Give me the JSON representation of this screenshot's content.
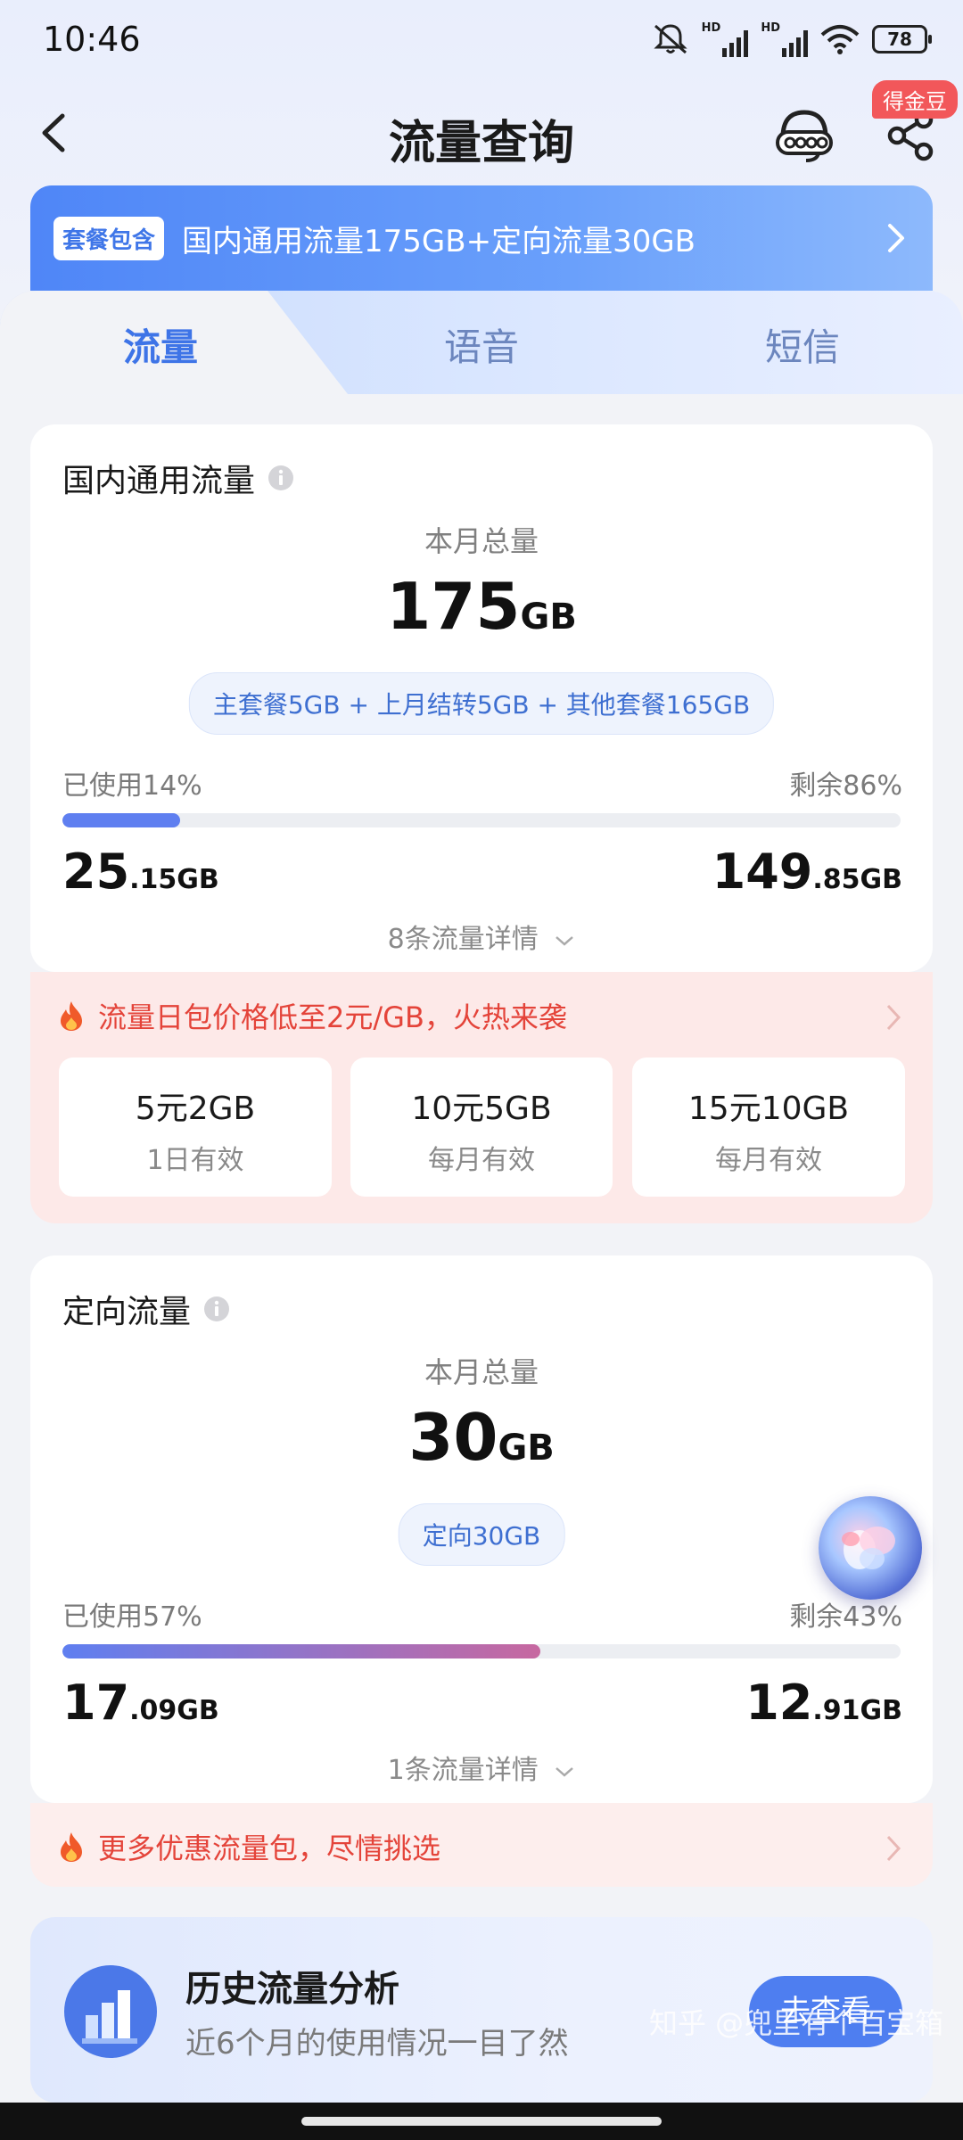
{
  "status_bar": {
    "time": "10:46",
    "battery": "78",
    "hd1": "HD",
    "hd2": "HD"
  },
  "nav": {
    "title": "流量查询",
    "badge": "得金豆"
  },
  "banner": {
    "tag": "套餐包含",
    "text": "国内通用流量175GB+定向流量30GB"
  },
  "tabs": [
    {
      "label": "流量"
    },
    {
      "label": "语音"
    },
    {
      "label": "短信"
    }
  ],
  "domestic": {
    "title": "国内通用流量",
    "month_label": "本月总量",
    "total_num": "175",
    "total_unit": "GB",
    "breakdown": "主套餐5GB + 上月结转5GB + 其他套餐165GB",
    "used_label": "已使用14%",
    "remain_label": "剩余86%",
    "used_fraction": 0.14,
    "used_int": "25",
    "used_dec": ".15GB",
    "remain_int": "149",
    "remain_dec": ".85GB",
    "detail": "8条流量详情"
  },
  "promo1": {
    "text": "流量日包价格低至2元/GB，火热来袭",
    "offers": [
      {
        "title": "5元2GB",
        "sub": "1日有效"
      },
      {
        "title": "10元5GB",
        "sub": "每月有效"
      },
      {
        "title": "15元10GB",
        "sub": "每月有效"
      }
    ]
  },
  "directed": {
    "title": "定向流量",
    "month_label": "本月总量",
    "total_num": "30",
    "total_unit": "GB",
    "breakdown": "定向30GB",
    "used_label": "已使用57%",
    "remain_label": "剩余43%",
    "used_fraction": 0.57,
    "used_int": "17",
    "used_dec": ".09GB",
    "remain_int": "12",
    "remain_dec": ".91GB",
    "detail": "1条流量详情"
  },
  "promo2": {
    "text": "更多优惠流量包，尽情挑选"
  },
  "history": {
    "title": "历史流量分析",
    "subtitle": "近6个月的使用情况一目了然",
    "button": "去查看"
  },
  "watermark": "知乎 @兜里有个百宝箱",
  "colors": {
    "accent": "#4e7ef0",
    "promo_red": "#e4443a",
    "used_bar_1": "#5f7ff0",
    "used_bar_2_end": "#c768a0"
  }
}
